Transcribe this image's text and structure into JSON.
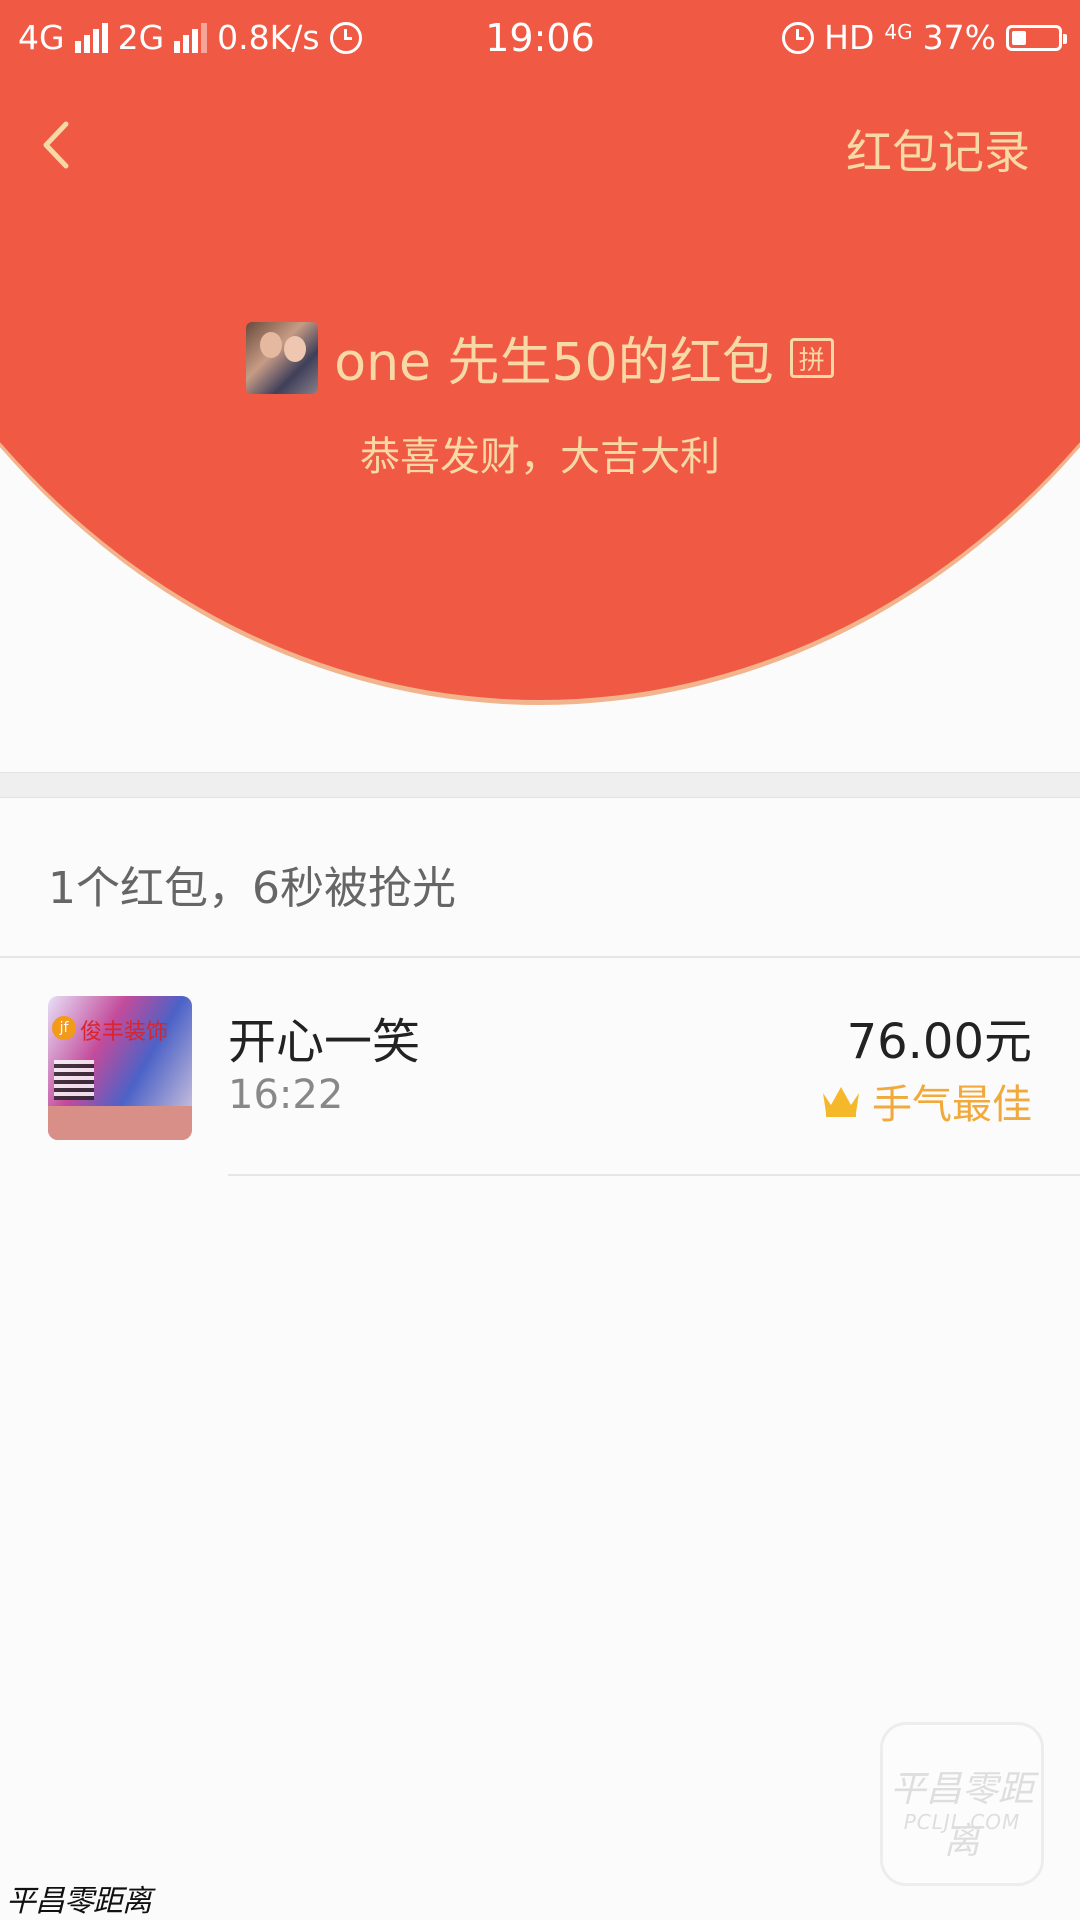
{
  "status_bar": {
    "net1": "4G",
    "net2": "2G",
    "speed": "0.8K/s",
    "time": "19:06",
    "hd": "HD",
    "net3": "4G",
    "battery": "37%"
  },
  "nav": {
    "record_label": "红包记录"
  },
  "envelope": {
    "sender_title": "one  先生50的红包",
    "pin_badge": "拼",
    "greeting": "恭喜发财，大吉大利"
  },
  "summary": "1个红包，6秒被抢光",
  "recipients": [
    {
      "name": "开心一笑",
      "time": "16:22",
      "amount": "76.00元",
      "tag": "手气最佳",
      "avatar_text": "俊丰装饰"
    }
  ],
  "watermark": {
    "big": "平昌零距离",
    "url": "PCLJL.COM",
    "small": "平昌零距离"
  },
  "colors": {
    "header_red": "#f05a45",
    "gold_text": "#f7d9a6",
    "best_luck": "#f1a93c"
  }
}
